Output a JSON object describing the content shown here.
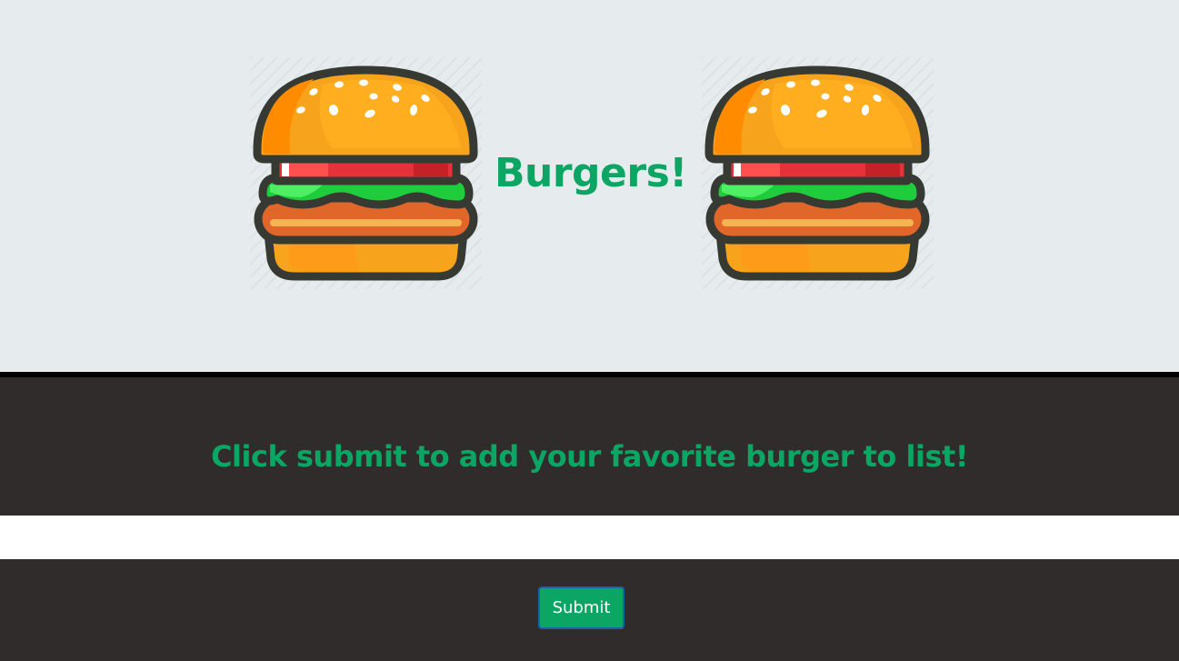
{
  "header": {
    "title": "Burgers!",
    "left_image": "burger-icon",
    "right_image": "burger-icon"
  },
  "form": {
    "prompt": "Click submit to add your favorite burger to list!",
    "input_value": "",
    "input_placeholder": "",
    "submit_label": "Submit"
  },
  "colors": {
    "accent": "#0ba564",
    "hero_background": "#e6ebee",
    "form_background": "#302c2c",
    "divider": "#000000"
  }
}
